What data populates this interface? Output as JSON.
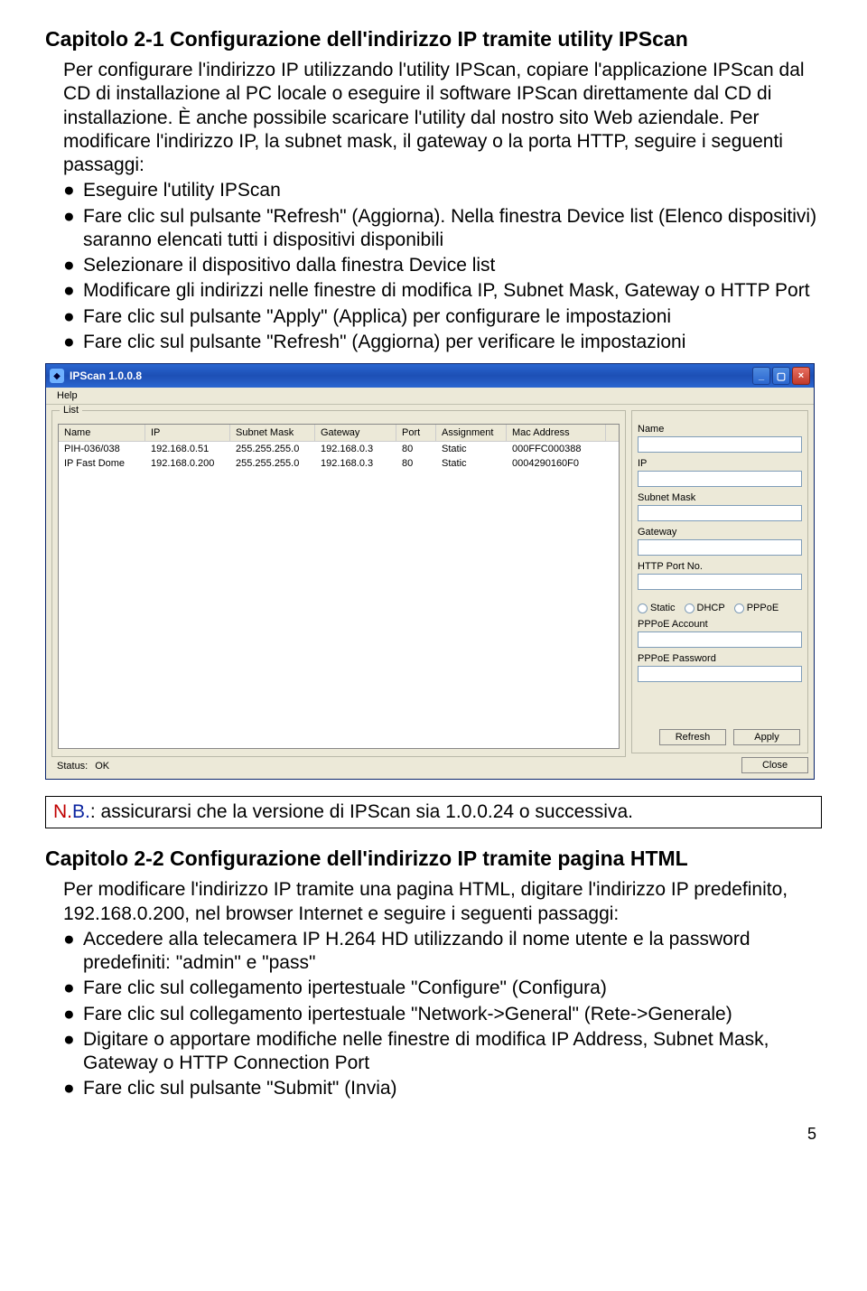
{
  "section1": {
    "heading": "Capitolo 2-1 Configurazione dell'indirizzo IP tramite utility IPScan",
    "para1": "Per configurare l'indirizzo IP utilizzando l'utility IPScan, copiare l'applicazione IPScan dal CD di installazione al PC locale o eseguire il software IPScan direttamente dal CD di installazione. È anche possibile scaricare l'utility dal nostro sito Web aziendale. Per modificare l'indirizzo IP, la subnet mask, il gateway o la porta HTTP, seguire i seguenti passaggi:",
    "bullets": [
      "Eseguire l'utility IPScan",
      "Fare clic sul pulsante \"Refresh\" (Aggiorna). Nella finestra Device list (Elenco dispositivi) saranno elencati tutti i dispositivi disponibili",
      "Selezionare il dispositivo dalla finestra Device list",
      "Modificare gli indirizzi nelle finestre di modifica IP, Subnet Mask, Gateway o HTTP Port",
      "Fare clic sul pulsante \"Apply\" (Applica) per configurare le impostazioni",
      "Fare clic sul pulsante \"Refresh\" (Aggiorna) per verificare le impostazioni"
    ]
  },
  "ipscan": {
    "title": "IPScan 1.0.0.8",
    "menu": {
      "help": "Help"
    },
    "list_legend": "List",
    "columns": {
      "name": "Name",
      "ip": "IP",
      "mask": "Subnet Mask",
      "gateway": "Gateway",
      "port": "Port",
      "assignment": "Assignment",
      "mac": "Mac Address"
    },
    "rows": [
      {
        "name": "PIH-036/038",
        "ip": "192.168.0.51",
        "mask": "255.255.255.0",
        "gateway": "192.168.0.3",
        "port": "80",
        "assignment": "Static",
        "mac": "000FFC000388"
      },
      {
        "name": "IP Fast Dome",
        "ip": "192.168.0.200",
        "mask": "255.255.255.0",
        "gateway": "192.168.0.3",
        "port": "80",
        "assignment": "Static",
        "mac": "0004290160F0"
      }
    ],
    "status_label": "Status:",
    "status_value": "OK",
    "fields": {
      "name": "Name",
      "ip": "IP",
      "mask": "Subnet Mask",
      "gateway": "Gateway",
      "httpport": "HTTP Port No.",
      "pppoe_account": "PPPoE Account",
      "pppoe_password": "PPPoE Password"
    },
    "radios": {
      "static": "Static",
      "dhcp": "DHCP",
      "pppoe": "PPPoE"
    },
    "buttons": {
      "refresh": "Refresh",
      "apply": "Apply",
      "close": "Close"
    }
  },
  "note": {
    "n": "N.",
    "b": "B.",
    "text": ": assicurarsi che la versione di IPScan sia 1.0.0.24 o successiva."
  },
  "section2": {
    "heading": "Capitolo 2-2 Configurazione dell'indirizzo IP tramite pagina HTML",
    "para1": "Per modificare l'indirizzo IP tramite una pagina HTML, digitare l'indirizzo IP predefinito, 192.168.0.200, nel browser Internet e seguire i seguenti passaggi:",
    "bullets": [
      "Accedere alla telecamera IP H.264 HD utilizzando il nome utente e la password predefiniti: \"admin\" e \"pass\"",
      "Fare clic sul collegamento ipertestuale \"Configure\" (Configura)",
      "Fare clic sul collegamento ipertestuale \"Network->General\" (Rete->Generale)",
      "Digitare o apportare modifiche nelle finestre di modifica IP Address, Subnet Mask, Gateway o HTTP Connection Port",
      "Fare clic sul pulsante \"Submit\" (Invia)"
    ]
  },
  "page_number": "5"
}
